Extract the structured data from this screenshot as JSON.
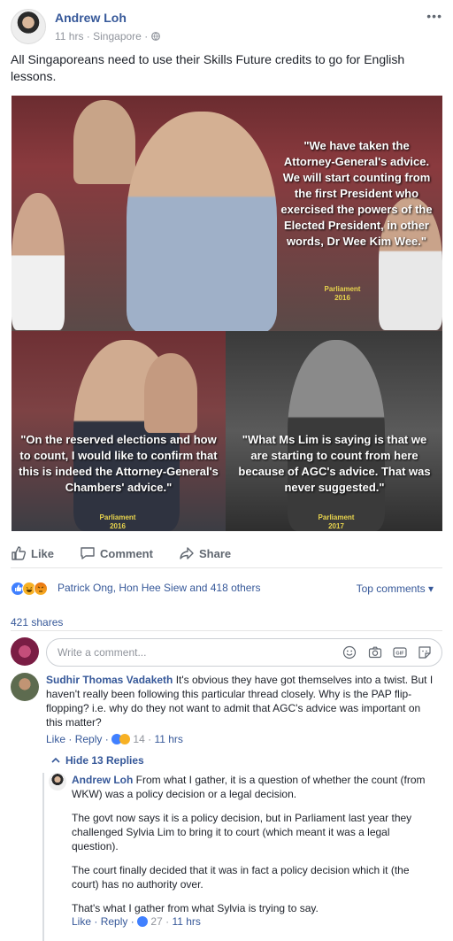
{
  "post": {
    "author": "Andrew Loh",
    "time": "11 hrs",
    "location": "Singapore",
    "more": "•••",
    "text": "All Singaporeans need to use their Skills Future credits to go for English lessons."
  },
  "image": {
    "quote_top": "\"We have taken the Attorney-General's advice. We will start counting from the first President who exercised the powers of the Elected President, in other words, Dr Wee Kim Wee.\"",
    "credit_top": "Parliament 2016",
    "quote_bl": "\"On the reserved elections and how to count, I would like to confirm that this is indeed the Attorney-General's Chambers' advice.\"",
    "credit_bl": "Parliament 2016",
    "quote_br": "\"What Ms Lim is saying is that we are starting to count from here because of AGC's advice. That was never suggested.\"",
    "credit_br": "Parliament 2017"
  },
  "actions": {
    "like": "Like",
    "comment": "Comment",
    "share": "Share"
  },
  "reactions": {
    "names": "Patrick Ong, Hon Hee Siew and 418 others",
    "top_comments": "Top comments ▾",
    "shares": "421 shares",
    "colors": {
      "like": "#4080ff",
      "haha": "#f7b125",
      "angry": "#e9710f"
    }
  },
  "comment_input": {
    "placeholder": "Write a comment..."
  },
  "comments": [
    {
      "name": "Sudhir Thomas Vadaketh",
      "text": "It's obvious they have got themselves into a twist. But I haven't really been following this particular thread closely. Why is the PAP flip-flopping? i.e. why do they not want to admit that AGC's advice was important on this matter?",
      "like": "Like",
      "reply": "Reply",
      "reaction_count": "14",
      "time": "11 hrs"
    }
  ],
  "hide_replies": "Hide 13 Replies",
  "replies": [
    {
      "name": "Andrew Loh",
      "p1": "From what I gather, it is a question of whether the count (from WKW) was a policy decision or a legal decision.",
      "p2": "The govt now says it is a policy decision, but in Parliament last year they challenged Sylvia Lim to bring it to court (which meant it was a legal question).",
      "p3": "The court finally decided that it was in fact a policy decision which it (the court) has no authority over.",
      "p4": "That's what I gather from what Sylvia is trying to say.",
      "like": "Like",
      "reply": "Reply",
      "reaction_count": "27",
      "time": "11 hrs"
    }
  ]
}
